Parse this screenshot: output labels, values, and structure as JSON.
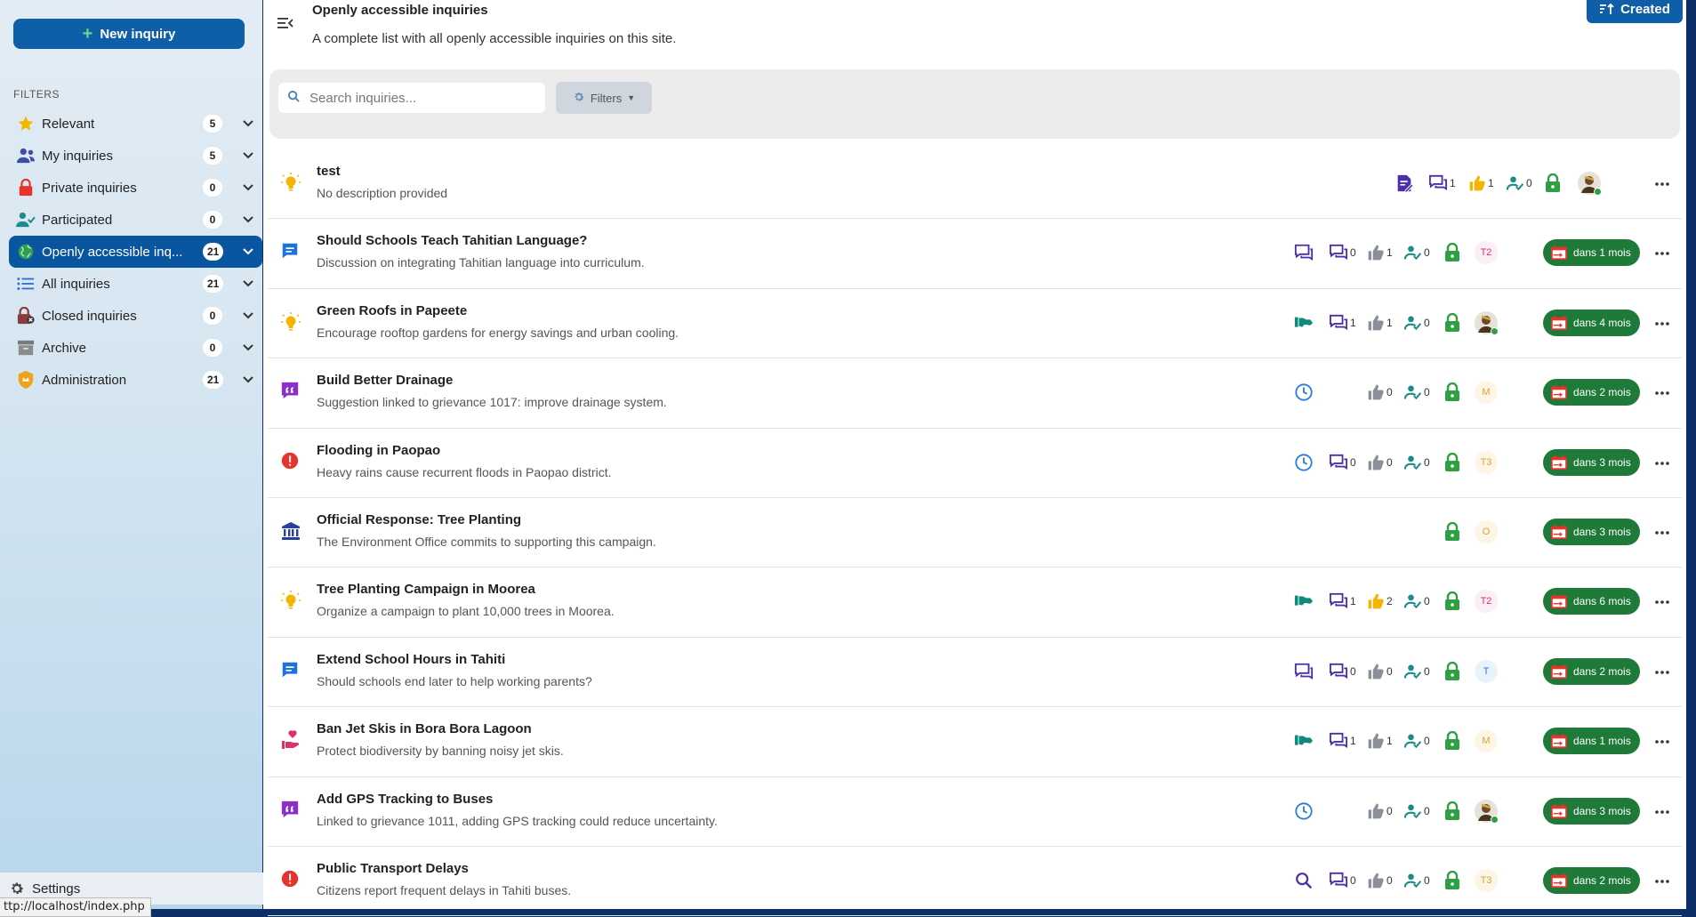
{
  "sidebar": {
    "new_button": "New inquiry",
    "filters_title": "FILTERS",
    "items": [
      {
        "label": "Relevant",
        "count": "5",
        "icon": "star-icon",
        "active": false
      },
      {
        "label": "My inquiries",
        "count": "5",
        "icon": "user-group-icon",
        "active": false
      },
      {
        "label": "Private inquiries",
        "count": "0",
        "icon": "lock-icon",
        "active": false
      },
      {
        "label": "Participated",
        "count": "0",
        "icon": "user-check-icon",
        "active": false
      },
      {
        "label": "Openly accessible inq...",
        "count": "21",
        "icon": "globe-icon",
        "active": true
      },
      {
        "label": "All inquiries",
        "count": "21",
        "icon": "list-icon",
        "active": false
      },
      {
        "label": "Closed inquiries",
        "count": "0",
        "icon": "lock-closed-icon",
        "active": false
      },
      {
        "label": "Archive",
        "count": "0",
        "icon": "archive-icon",
        "active": false
      },
      {
        "label": "Administration",
        "count": "21",
        "icon": "shield-icon",
        "active": false
      }
    ],
    "settings_label": "Settings"
  },
  "status_url": "ttp://localhost/index.php",
  "header": {
    "title": "Openly accessible inquiries",
    "description": "A complete list with all openly accessible inquiries on this site.",
    "sort_label": "Created"
  },
  "toolbar": {
    "search_placeholder": "Search inquiries...",
    "filters_label": "Filters"
  },
  "colors": {
    "primary": "#0e5ea8",
    "deadline": "#1f7a3a",
    "lock": "#2ea043",
    "purple": "#4b2ea8"
  },
  "inquiries": [
    {
      "title": "test",
      "description": "No description provided",
      "type_icon": "lightbulb-icon",
      "status_icon": "edit-icon",
      "comments": "1",
      "likes": "1",
      "likes_active": true,
      "participants": "0",
      "avatar": "",
      "avatar_photo": true,
      "deadline": ""
    },
    {
      "title": "Should Schools Teach Tahitian Language?",
      "description": "Discussion on integrating Tahitian language into curriculum.",
      "type_icon": "chat-icon",
      "status_icon": "discussion-icon",
      "comments": "0",
      "likes": "1",
      "likes_active": false,
      "participants": "0",
      "avatar": "T2",
      "avatar_photo": false,
      "deadline": "dans 1 mois"
    },
    {
      "title": "Green Roofs in Papeete",
      "description": "Encourage rooftop gardens for energy savings and urban cooling.",
      "type_icon": "lightbulb-icon",
      "status_icon": "handshake-icon",
      "comments": "1",
      "likes": "1",
      "likes_active": false,
      "participants": "0",
      "avatar": "",
      "avatar_photo": true,
      "deadline": "dans 4 mois"
    },
    {
      "title": "Build Better Drainage",
      "description": "Suggestion linked to grievance 1017: improve drainage system.",
      "type_icon": "quote-icon",
      "status_icon": "clock-icon",
      "comments": "",
      "likes": "0",
      "likes_active": false,
      "participants": "0",
      "avatar": "M",
      "avatar_photo": false,
      "deadline": "dans 2 mois"
    },
    {
      "title": "Flooding in Paopao",
      "description": "Heavy rains cause recurrent floods in Paopao district.",
      "type_icon": "alert-icon",
      "status_icon": "clock-icon",
      "comments": "0",
      "likes": "0",
      "likes_active": false,
      "participants": "0",
      "avatar": "T3",
      "avatar_photo": false,
      "deadline": "dans 3 mois"
    },
    {
      "title": "Official Response: Tree Planting",
      "description": "The Environment Office commits to supporting this campaign.",
      "type_icon": "bank-icon",
      "status_icon": "",
      "comments": "",
      "likes": "",
      "likes_active": false,
      "participants": "",
      "avatar": "O",
      "avatar_photo": false,
      "deadline": "dans 3 mois"
    },
    {
      "title": "Tree Planting Campaign in Moorea",
      "description": "Organize a campaign to plant 10,000 trees in Moorea.",
      "type_icon": "lightbulb-icon",
      "status_icon": "handshake-icon",
      "comments": "1",
      "likes": "2",
      "likes_active": true,
      "participants": "0",
      "avatar": "T2",
      "avatar_photo": false,
      "deadline": "dans 6 mois"
    },
    {
      "title": "Extend School Hours in Tahiti",
      "description": "Should schools end later to help working parents?",
      "type_icon": "chat-icon",
      "status_icon": "discussion-icon",
      "comments": "0",
      "likes": "0",
      "likes_active": false,
      "participants": "0",
      "avatar": "T",
      "avatar_photo": false,
      "deadline": "dans 2 mois"
    },
    {
      "title": "Ban Jet Skis in Bora Bora Lagoon",
      "description": "Protect biodiversity by banning noisy jet skis.",
      "type_icon": "heart-hand-icon",
      "status_icon": "handshake-icon",
      "comments": "1",
      "likes": "1",
      "likes_active": false,
      "participants": "0",
      "avatar": "M",
      "avatar_photo": false,
      "deadline": "dans 1 mois"
    },
    {
      "title": "Add GPS Tracking to Buses",
      "description": "Linked to grievance 1011, adding GPS tracking could reduce uncertainty.",
      "type_icon": "quote-icon",
      "status_icon": "clock-icon",
      "comments": "",
      "likes": "0",
      "likes_active": false,
      "participants": "0",
      "avatar": "",
      "avatar_photo": true,
      "deadline": "dans 3 mois"
    },
    {
      "title": "Public Transport Delays",
      "description": "Citizens report frequent delays in Tahiti buses.",
      "type_icon": "alert-icon",
      "status_icon": "search-icon",
      "comments": "0",
      "likes": "0",
      "likes_active": false,
      "participants": "0",
      "avatar": "T3",
      "avatar_photo": false,
      "deadline": "dans 2 mois"
    }
  ]
}
